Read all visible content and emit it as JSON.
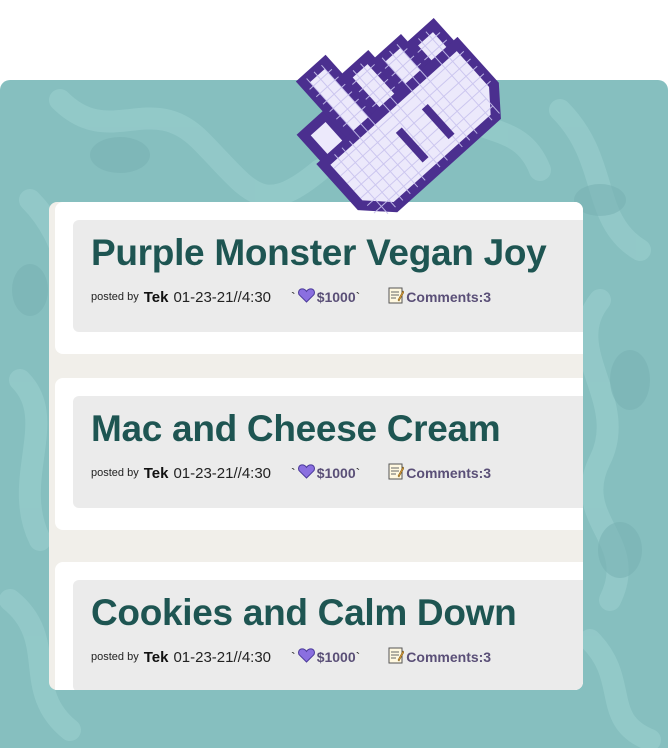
{
  "colors": {
    "background": "#86bfbf",
    "title": "#1e5552",
    "heart": "#8a6fe0",
    "cursor_outline": "#4b2f8f",
    "cursor_fill": "#ece9fb"
  },
  "posts": [
    {
      "title": "Purple Monster Vegan Joy",
      "posted_by_label": "posted by",
      "author": "Tek",
      "date": "01-23-21//4:30",
      "likes_open": "`",
      "likes_amount": "$1000",
      "likes_close": "`",
      "likes_icon": "purple-heart-icon",
      "comments_icon": "memo-icon",
      "comments_label": "Comments:3"
    },
    {
      "title": "Mac and Cheese Cream",
      "posted_by_label": "posted by",
      "author": "Tek",
      "date": "01-23-21//4:30",
      "likes_open": "`",
      "likes_amount": "$1000",
      "likes_close": "`",
      "likes_icon": "purple-heart-icon",
      "comments_icon": "memo-icon",
      "comments_label": "Comments:3"
    },
    {
      "title": "Cookies and Calm Down",
      "posted_by_label": "posted by",
      "author": "Tek",
      "date": "01-23-21//4:30",
      "likes_open": "`",
      "likes_amount": "$1000",
      "likes_close": "`",
      "likes_icon": "purple-heart-icon",
      "comments_icon": "memo-icon",
      "comments_label": "Comments:3"
    }
  ],
  "cursor_icon": "pixel-pointing-hand-cursor-icon"
}
